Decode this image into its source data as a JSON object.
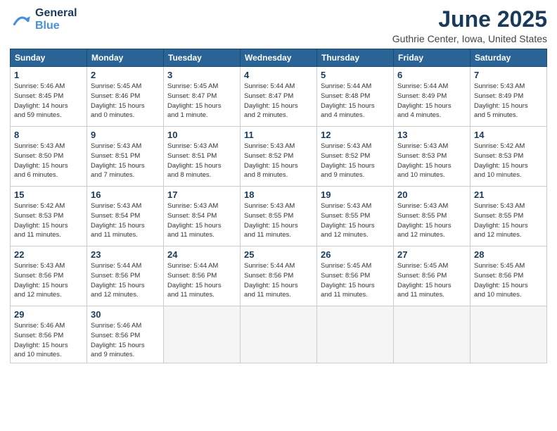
{
  "logo": {
    "line1": "General",
    "line2": "Blue"
  },
  "title": "June 2025",
  "subtitle": "Guthrie Center, Iowa, United States",
  "days_of_week": [
    "Sunday",
    "Monday",
    "Tuesday",
    "Wednesday",
    "Thursday",
    "Friday",
    "Saturday"
  ],
  "weeks": [
    [
      {
        "day": "1",
        "text": "Sunrise: 5:46 AM\nSunset: 8:45 PM\nDaylight: 14 hours\nand 59 minutes."
      },
      {
        "day": "2",
        "text": "Sunrise: 5:45 AM\nSunset: 8:46 PM\nDaylight: 15 hours\nand 0 minutes."
      },
      {
        "day": "3",
        "text": "Sunrise: 5:45 AM\nSunset: 8:47 PM\nDaylight: 15 hours\nand 1 minute."
      },
      {
        "day": "4",
        "text": "Sunrise: 5:44 AM\nSunset: 8:47 PM\nDaylight: 15 hours\nand 2 minutes."
      },
      {
        "day": "5",
        "text": "Sunrise: 5:44 AM\nSunset: 8:48 PM\nDaylight: 15 hours\nand 4 minutes."
      },
      {
        "day": "6",
        "text": "Sunrise: 5:44 AM\nSunset: 8:49 PM\nDaylight: 15 hours\nand 4 minutes."
      },
      {
        "day": "7",
        "text": "Sunrise: 5:43 AM\nSunset: 8:49 PM\nDaylight: 15 hours\nand 5 minutes."
      }
    ],
    [
      {
        "day": "8",
        "text": "Sunrise: 5:43 AM\nSunset: 8:50 PM\nDaylight: 15 hours\nand 6 minutes."
      },
      {
        "day": "9",
        "text": "Sunrise: 5:43 AM\nSunset: 8:51 PM\nDaylight: 15 hours\nand 7 minutes."
      },
      {
        "day": "10",
        "text": "Sunrise: 5:43 AM\nSunset: 8:51 PM\nDaylight: 15 hours\nand 8 minutes."
      },
      {
        "day": "11",
        "text": "Sunrise: 5:43 AM\nSunset: 8:52 PM\nDaylight: 15 hours\nand 8 minutes."
      },
      {
        "day": "12",
        "text": "Sunrise: 5:43 AM\nSunset: 8:52 PM\nDaylight: 15 hours\nand 9 minutes."
      },
      {
        "day": "13",
        "text": "Sunrise: 5:43 AM\nSunset: 8:53 PM\nDaylight: 15 hours\nand 10 minutes."
      },
      {
        "day": "14",
        "text": "Sunrise: 5:42 AM\nSunset: 8:53 PM\nDaylight: 15 hours\nand 10 minutes."
      }
    ],
    [
      {
        "day": "15",
        "text": "Sunrise: 5:42 AM\nSunset: 8:53 PM\nDaylight: 15 hours\nand 11 minutes."
      },
      {
        "day": "16",
        "text": "Sunrise: 5:43 AM\nSunset: 8:54 PM\nDaylight: 15 hours\nand 11 minutes."
      },
      {
        "day": "17",
        "text": "Sunrise: 5:43 AM\nSunset: 8:54 PM\nDaylight: 15 hours\nand 11 minutes."
      },
      {
        "day": "18",
        "text": "Sunrise: 5:43 AM\nSunset: 8:55 PM\nDaylight: 15 hours\nand 11 minutes."
      },
      {
        "day": "19",
        "text": "Sunrise: 5:43 AM\nSunset: 8:55 PM\nDaylight: 15 hours\nand 12 minutes."
      },
      {
        "day": "20",
        "text": "Sunrise: 5:43 AM\nSunset: 8:55 PM\nDaylight: 15 hours\nand 12 minutes."
      },
      {
        "day": "21",
        "text": "Sunrise: 5:43 AM\nSunset: 8:55 PM\nDaylight: 15 hours\nand 12 minutes."
      }
    ],
    [
      {
        "day": "22",
        "text": "Sunrise: 5:43 AM\nSunset: 8:56 PM\nDaylight: 15 hours\nand 12 minutes."
      },
      {
        "day": "23",
        "text": "Sunrise: 5:44 AM\nSunset: 8:56 PM\nDaylight: 15 hours\nand 12 minutes."
      },
      {
        "day": "24",
        "text": "Sunrise: 5:44 AM\nSunset: 8:56 PM\nDaylight: 15 hours\nand 11 minutes."
      },
      {
        "day": "25",
        "text": "Sunrise: 5:44 AM\nSunset: 8:56 PM\nDaylight: 15 hours\nand 11 minutes."
      },
      {
        "day": "26",
        "text": "Sunrise: 5:45 AM\nSunset: 8:56 PM\nDaylight: 15 hours\nand 11 minutes."
      },
      {
        "day": "27",
        "text": "Sunrise: 5:45 AM\nSunset: 8:56 PM\nDaylight: 15 hours\nand 11 minutes."
      },
      {
        "day": "28",
        "text": "Sunrise: 5:45 AM\nSunset: 8:56 PM\nDaylight: 15 hours\nand 10 minutes."
      }
    ],
    [
      {
        "day": "29",
        "text": "Sunrise: 5:46 AM\nSunset: 8:56 PM\nDaylight: 15 hours\nand 10 minutes."
      },
      {
        "day": "30",
        "text": "Sunrise: 5:46 AM\nSunset: 8:56 PM\nDaylight: 15 hours\nand 9 minutes."
      },
      {
        "day": "",
        "text": ""
      },
      {
        "day": "",
        "text": ""
      },
      {
        "day": "",
        "text": ""
      },
      {
        "day": "",
        "text": ""
      },
      {
        "day": "",
        "text": ""
      }
    ]
  ]
}
